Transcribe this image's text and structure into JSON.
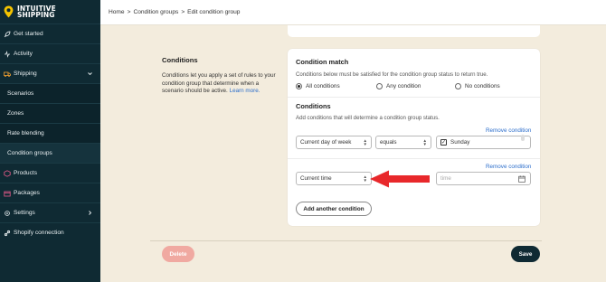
{
  "brand": {
    "line1": "INTUITIVE",
    "line2": "SHIPPING"
  },
  "sidebar": {
    "items": [
      {
        "label": "Get started",
        "icon": "rocket-icon"
      },
      {
        "label": "Activity",
        "icon": "activity-icon"
      },
      {
        "label": "Shipping",
        "icon": "truck-icon"
      },
      {
        "label": "Scenarios"
      },
      {
        "label": "Zones"
      },
      {
        "label": "Rate blending"
      },
      {
        "label": "Condition groups"
      },
      {
        "label": "Products",
        "icon": "box-icon"
      },
      {
        "label": "Packages",
        "icon": "package-icon"
      },
      {
        "label": "Settings",
        "icon": "gear-icon"
      },
      {
        "label": "Shopify connection",
        "icon": "link-icon"
      }
    ]
  },
  "breadcrumb": {
    "home": "Home",
    "sep": ">",
    "groups": "Condition groups",
    "current": "Edit condition group"
  },
  "description": {
    "title": "Conditions",
    "text": "Conditions let you apply a set of rules to your condition group that determine when a scenario should be active.",
    "link": "Learn more."
  },
  "condition_match": {
    "title": "Condition match",
    "hint": "Conditions below must be satisfied for the condition group status to return true.",
    "options": [
      "All conditions",
      "Any condition",
      "No conditions"
    ],
    "selected": "All conditions"
  },
  "conditions": {
    "title": "Conditions",
    "hint": "Add conditions that will determine a condition group status.",
    "remove_label": "Remove condition",
    "row1": {
      "field": "Current day of week",
      "operator": "equals",
      "value": "Sunday"
    },
    "row2": {
      "field": "Current time",
      "value_placeholder": "time"
    },
    "add_label": "Add another condition"
  },
  "footer": {
    "delete_label": "Delete",
    "save_label": "Save"
  },
  "colors": {
    "sidebar": "#0f2a33",
    "background": "#f3ecdd",
    "link": "#2c6ecb",
    "delete": "#f0a9a1",
    "arrow": "#e8282b",
    "logo_pin": "#f4c400"
  }
}
